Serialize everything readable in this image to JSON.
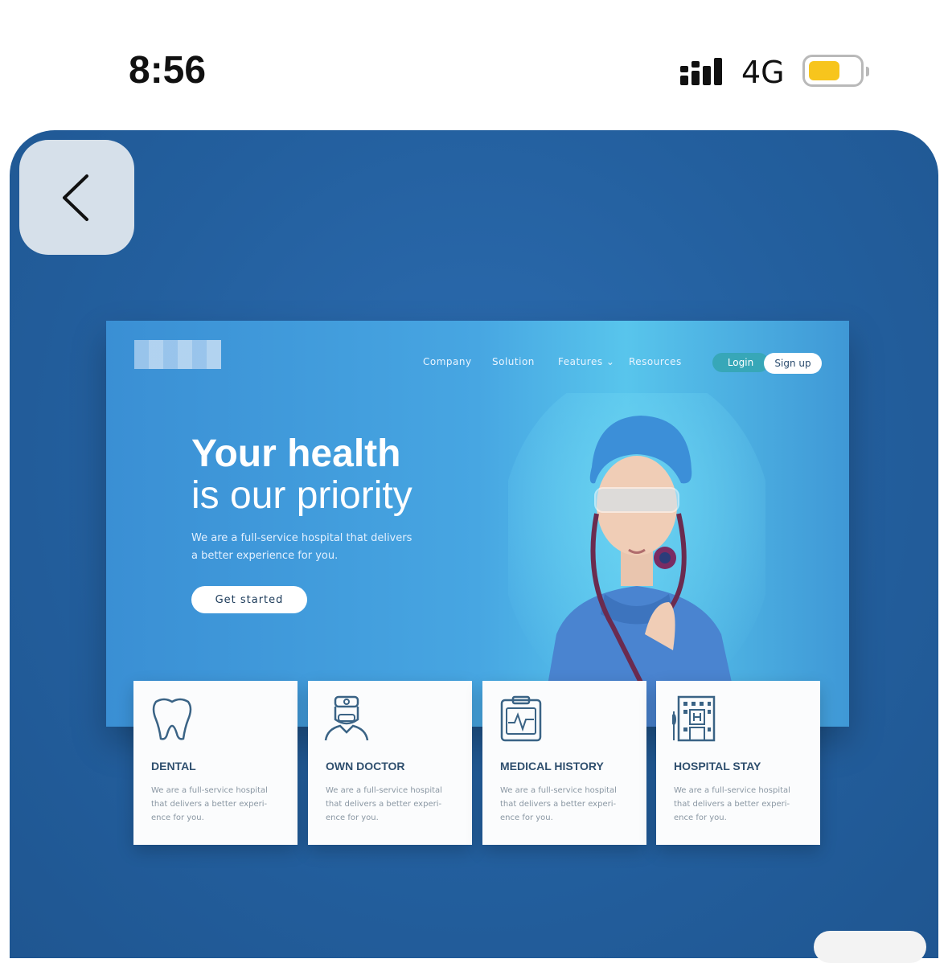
{
  "status_bar": {
    "time": "8:56",
    "network": "4G",
    "battery_color": "#f7c51d"
  },
  "back_button": {
    "icon": "chevron-left-icon"
  },
  "mockup": {
    "nav": {
      "company": "Company",
      "solution": "Solution",
      "features": "Features ⌄",
      "resources": "Resources",
      "login": "Login",
      "signup": "Sign up"
    },
    "hero": {
      "title_bold": "Your health",
      "title_light": "is our priority",
      "subtitle_line1": "We are a full-service hospital that delivers",
      "subtitle_line2": "a better experience for you.",
      "cta": "Get started"
    },
    "features": [
      {
        "icon": "tooth-icon",
        "title": "DENTAL",
        "desc": "We are a full-service hospital that delivers a better experi-ence for you."
      },
      {
        "icon": "doctor-icon",
        "title": "OWN DOCTOR",
        "desc": "We are a full-service hospital that delivers a better experi-ence for you."
      },
      {
        "icon": "clipboard-heartbeat-icon",
        "title": "MEDICAL HISTORY",
        "desc": "We are a full-service hospital that delivers a better experi-ence for you."
      },
      {
        "icon": "hospital-building-icon",
        "title": "HOSPITAL STAY",
        "desc": "We are a full-service hospital that delivers a better experi-ence for you."
      }
    ]
  }
}
